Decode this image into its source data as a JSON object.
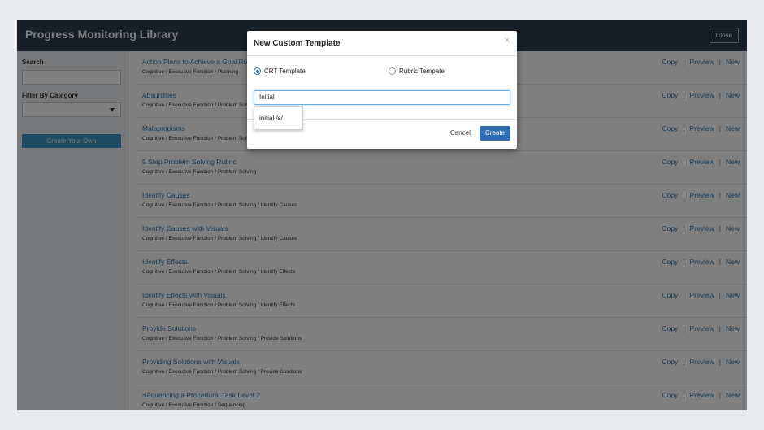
{
  "header": {
    "title": "Progress Monitoring Library",
    "close_label": "Close"
  },
  "sidebar": {
    "search_label": "Search",
    "filter_label": "Filter By Category",
    "create_own_label": "Create Your Own"
  },
  "actions": {
    "copy": "Copy",
    "preview": "Preview",
    "new": "New",
    "sep": "|"
  },
  "rows": [
    {
      "title": "Action Plans to Achieve a Goal Rubric",
      "path": "Cognitive / Executive Function / Planning"
    },
    {
      "title": "Absurdities",
      "path": "Cognitive / Executive Function / Problem Solving"
    },
    {
      "title": "Malapropisms",
      "path": "Cognitive / Executive Function / Problem Solving"
    },
    {
      "title": "5 Step Problem Solving Rubric",
      "path": "Cognitive / Executive Function / Problem Solving"
    },
    {
      "title": "Identify Causes",
      "path": "Cognitive / Executive Function / Problem Solving / Identify Causes"
    },
    {
      "title": "Identify Causes with Visuals",
      "path": "Cognitive / Executive Function / Problem Solving / Identify Causes"
    },
    {
      "title": "Identify Effects",
      "path": "Cognitive / Executive Function / Problem Solving / Identify Effects"
    },
    {
      "title": "Identify Effects with Visuals",
      "path": "Cognitive / Executive Function / Problem Solving / Identify Effects"
    },
    {
      "title": "Provide Solutions",
      "path": "Cognitive / Executive Function / Problem Solving / Provide Solutions"
    },
    {
      "title": "Providing Solutions with Visuals",
      "path": "Cognitive / Executive Function / Problem Solving / Provide Solutions"
    },
    {
      "title": "Sequencing a Procedural Task Level 2",
      "path": "Cognitive / Executive Function / Sequencing"
    }
  ],
  "modal": {
    "title": "New Custom Template",
    "close_glyph": "×",
    "radio_crt": "CRT Template",
    "radio_rubric": "Rubric Tempate",
    "input_value": "Initial",
    "cancel_label": "Cancel",
    "create_label": "Create",
    "suggestion": "initial /s/"
  },
  "colors": {
    "link": "#2a7ab6",
    "header_bg": "#2c3e50",
    "primary": "#2f6db0"
  }
}
